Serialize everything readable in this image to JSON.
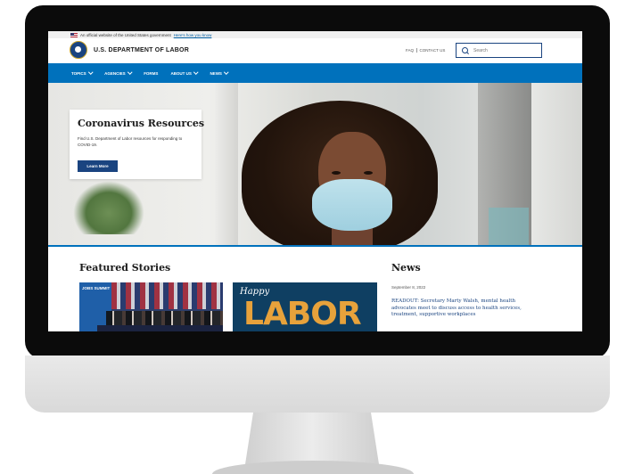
{
  "gov_banner": {
    "text": "An official website of the United States government",
    "link": "Here's how you know"
  },
  "header": {
    "agency_name": "U.S. DEPARTMENT OF LABOR",
    "faq": "FAQ",
    "contact": "CONTACT US",
    "search_placeholder": "Search"
  },
  "nav": {
    "items": [
      {
        "label": "TOPICS",
        "dropdown": true
      },
      {
        "label": "AGENCIES",
        "dropdown": true
      },
      {
        "label": "FORMS",
        "dropdown": false
      },
      {
        "label": "ABOUT US",
        "dropdown": true
      },
      {
        "label": "NEWS",
        "dropdown": true
      }
    ]
  },
  "hero": {
    "title": "Coronavirus Resources",
    "description": "Find U.S. Department of Labor resources for responding to COVID-19.",
    "button": "Learn More"
  },
  "featured": {
    "title": "Featured Stories",
    "story1_banner": "JOBS SUMMIT",
    "story2_line1": "Happy",
    "story2_line2": "LABOR"
  },
  "news": {
    "title": "News",
    "date": "September 8, 2022",
    "headline": "READOUT: Secretary Marty Walsh, mental health advocates meet to discuss access to health services, treatment, supportive workplaces"
  },
  "colors": {
    "nav_blue": "#0071bc",
    "brand_navy": "#1a4480",
    "monitor_bezel": "#0b0b0b"
  }
}
